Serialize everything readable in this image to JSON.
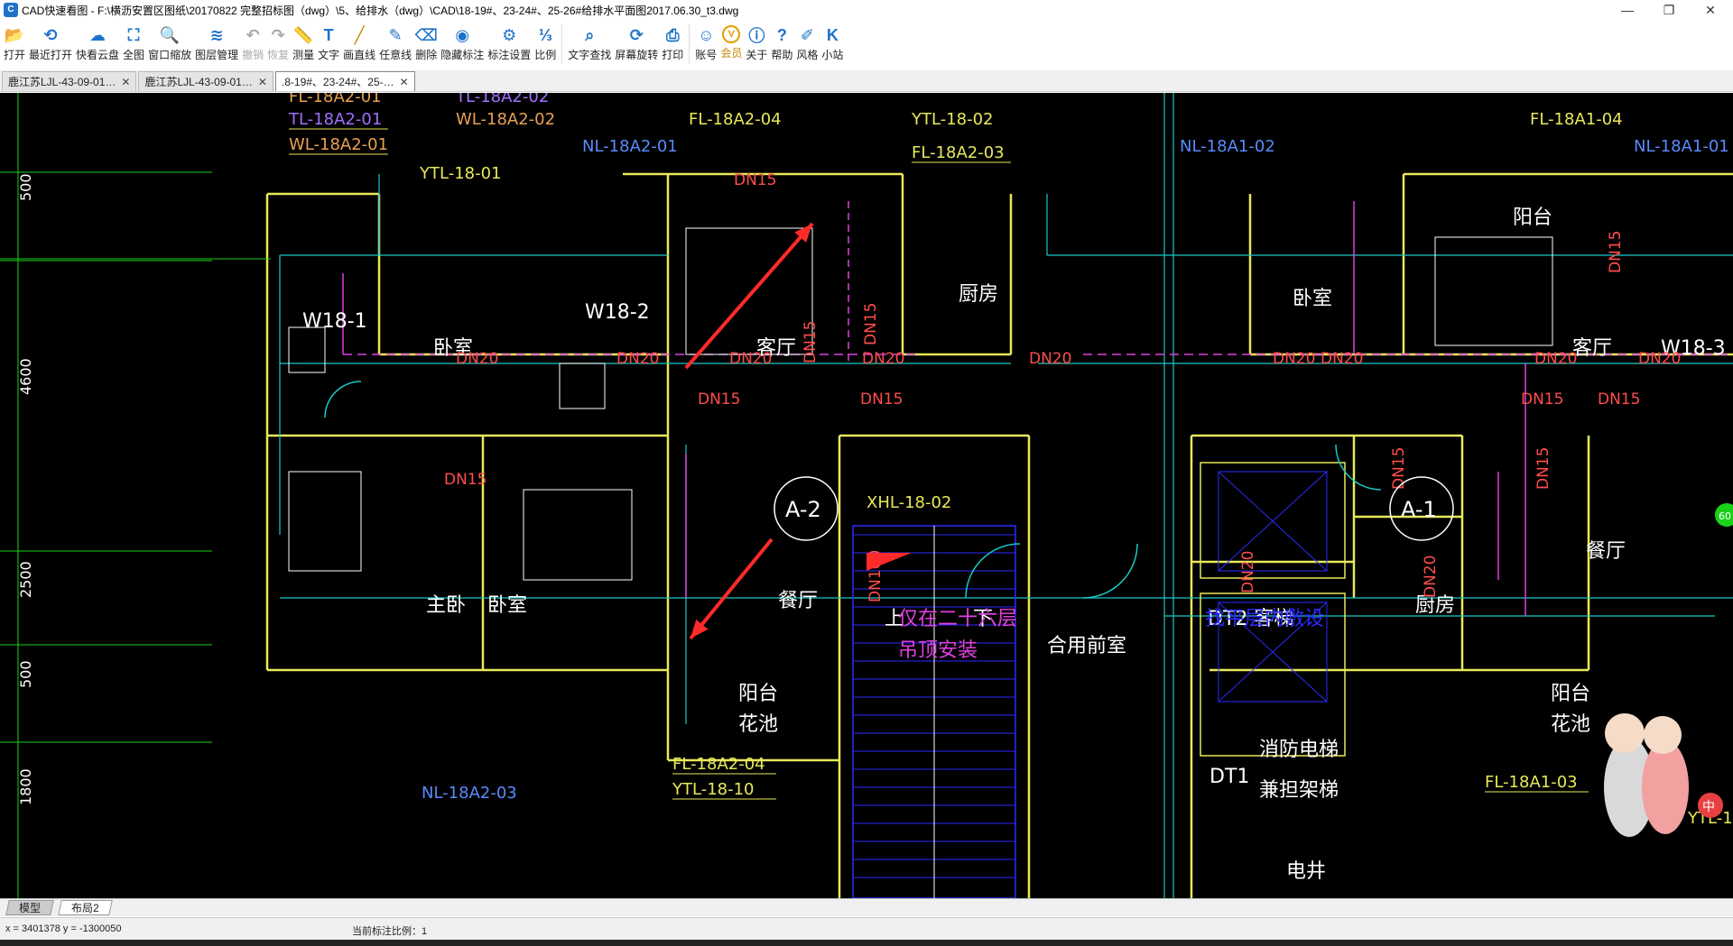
{
  "window": {
    "title": "CAD快速看图 - F:\\横沥安置区图纸\\20170822 完整招标图（dwg）\\5、给排水（dwg）\\CAD\\18-19#、23-24#、25-26#给排水平面图2017.06.30_t3.dwg",
    "app_icon": "cad-app-icon",
    "minimize_symbol": "—",
    "restore_symbol": "❐",
    "close_symbol": "✕"
  },
  "toolbar": {
    "items": [
      {
        "label": "打开",
        "icon": "open-folder-icon",
        "color": "#1e73c9"
      },
      {
        "label": "最近打开",
        "icon": "recent-icon",
        "color": "#1e73c9"
      },
      {
        "label": "快看云盘",
        "icon": "cloud-icon",
        "color": "#1e73c9"
      },
      {
        "label": "全图",
        "icon": "fit-all-icon",
        "color": "#1e73c9"
      },
      {
        "label": "窗口缩放",
        "icon": "window-zoom-icon",
        "color": "#1e73c9"
      },
      {
        "label": "图层管理",
        "icon": "layers-icon",
        "color": "#1e73c9"
      },
      {
        "label": "撤销",
        "icon": "undo-icon",
        "color": "#aaa",
        "disabled": true
      },
      {
        "label": "恢复",
        "icon": "redo-icon",
        "color": "#aaa",
        "disabled": true
      },
      {
        "label": "测量",
        "icon": "measure-icon",
        "color": "#1e73c9"
      },
      {
        "label": "文字",
        "icon": "text-icon",
        "color": "#1e73c9"
      },
      {
        "label": "画直线",
        "icon": "line-icon",
        "color": "#c48a00"
      },
      {
        "label": "任意线",
        "icon": "pen-icon",
        "color": "#1e73c9"
      },
      {
        "label": "删除",
        "icon": "eraser-icon",
        "color": "#1e73c9"
      },
      {
        "label": "隐藏标注",
        "icon": "eye-icon",
        "color": "#1e73c9"
      },
      {
        "label": "标注设置",
        "icon": "settings-icon",
        "color": "#1e73c9"
      },
      {
        "label": "比例",
        "icon": "scale-icon",
        "color": "#1e73c9"
      },
      {
        "label": "文字查找",
        "icon": "find-text-icon",
        "color": "#1e73c9"
      },
      {
        "label": "屏幕旋转",
        "icon": "rotate-icon",
        "color": "#1e73c9"
      },
      {
        "label": "打印",
        "icon": "print-icon",
        "color": "#1e73c9"
      },
      {
        "label": "账号",
        "icon": "user-icon",
        "color": "#1e73c9"
      },
      {
        "label": "会员",
        "icon": "vip-icon",
        "color": "#e0a000",
        "member": true
      },
      {
        "label": "关于",
        "icon": "info-icon",
        "color": "#1e73c9"
      },
      {
        "label": "帮助",
        "icon": "help-icon",
        "color": "#1e73c9"
      },
      {
        "label": "风格",
        "icon": "style-icon",
        "color": "#1e73c9"
      },
      {
        "label": "小站",
        "icon": "site-k-icon",
        "color": "#1e73c9"
      }
    ]
  },
  "tabs": [
    {
      "label": "鹿江苏LJL-43-09-01…",
      "active": false
    },
    {
      "label": "鹿江苏LJL-43-09-01…",
      "active": false
    },
    {
      "label": ".8-19#、23-24#、25-…",
      "active": true
    }
  ],
  "tab_close": "✕",
  "layout_tabs": [
    {
      "label": "模型",
      "active": true
    },
    {
      "label": "布局2",
      "active": false
    }
  ],
  "status": {
    "coords": "x = 3401378  y = -1300050",
    "scale": "当前标注比例：1"
  },
  "drawing": {
    "dims": [
      "500",
      "4600",
      "2500",
      "500",
      "1800"
    ],
    "labels_yellow": [
      "W18-1",
      "卧室",
      "W18-2",
      "客厅",
      "厨房",
      "主卧",
      "卧室",
      "餐厅",
      "阳台",
      "花池",
      "阳台",
      "卧室",
      "客厅",
      "W18-3",
      "厨房",
      "餐厅",
      "阳台",
      "花池",
      "合用前室",
      "DT2 客梯",
      "DT1",
      "消防电梯",
      "兼担架梯",
      "电井",
      "上",
      "下"
    ],
    "pipe_tags": [
      "FL-18A2-01",
      "TL-18A2-01",
      "WL-18A2-01",
      "TL-18A2-02",
      "WL-18A2-02",
      "YTL-18-01",
      "NL-18A2-01",
      "FL-18A2-04",
      "YTL-18-02",
      "FL-18A2-03",
      "NL-18A1-02",
      "FL-18A1-04",
      "NL-18A1-01",
      "XHL-18-02",
      "FL-18A2-04",
      "YTL-18-10",
      "NL-18A2-03",
      "FL-18A1-03",
      "YTL-1"
    ],
    "pipe_sizes": [
      "DN15",
      "DN20",
      "DN20",
      "DN20",
      "DN20",
      "DN15",
      "DN15",
      "DN15",
      "DN20",
      "DN20",
      "DN20",
      "DN20",
      "DN15",
      "DN15",
      "DN20",
      "DN15",
      "DN15",
      "DN100",
      "DN20",
      "DN15",
      "DN15",
      "DN15",
      "DN20"
    ],
    "callouts": [
      "A-2",
      "A-1"
    ],
    "notes": [
      "仅在二十六层",
      "吊顶安装",
      "找平层内敷设"
    ],
    "badge": "60",
    "mascot_char": "中"
  }
}
